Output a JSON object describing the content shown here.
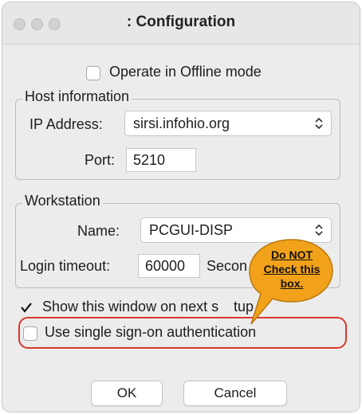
{
  "window": {
    "title": ": Configuration"
  },
  "offline": {
    "label": "Operate in Offline mode",
    "checked": false
  },
  "host": {
    "legend": "Host information",
    "ip_label": "IP Address:",
    "ip_value": "sirsi.infohio.org",
    "port_label": "Port:",
    "port_value": "5210"
  },
  "workstation": {
    "legend": "Workstation",
    "name_label": "Name:",
    "name_value": "PCGUI-DISP",
    "timeout_label": "Login timeout:",
    "timeout_value": "60000",
    "seconds_label": "Secon"
  },
  "show_window": {
    "label": "Show this window on next s",
    "label_tail": "tup",
    "checked": true
  },
  "sso": {
    "label": "Use single sign-on authentication",
    "checked": false
  },
  "buttons": {
    "ok": "OK",
    "cancel": "Cancel"
  },
  "callout": {
    "line1": "Do NOT",
    "line2": "Check this",
    "line3": "box."
  },
  "colors": {
    "callout_fill": "#f2a21a",
    "highlight": "#d9382b"
  }
}
